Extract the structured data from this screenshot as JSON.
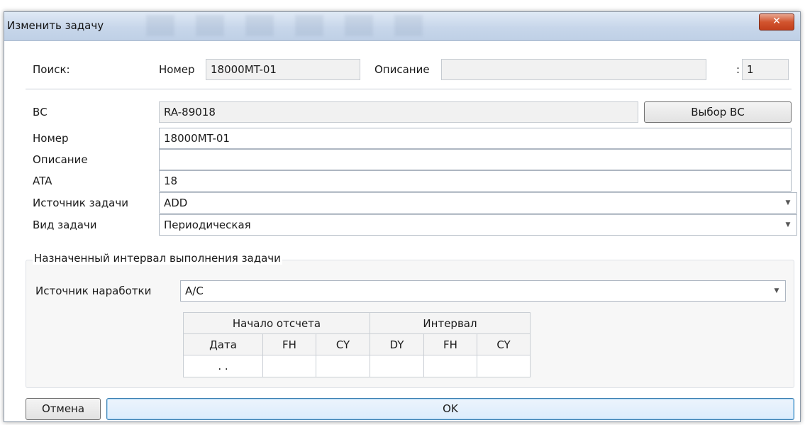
{
  "window": {
    "title": "Изменить задачу",
    "close_glyph": "✕"
  },
  "search": {
    "label": "Поиск:",
    "number_label": "Номер",
    "number_value": "18000MT-01",
    "description_label": "Описание",
    "description_value": "",
    "count_label": ":",
    "count_value": "1"
  },
  "fields": {
    "vs_label": "ВС",
    "vs_value": "RA-89018",
    "vs_button": "Выбор ВС",
    "number_label": "Номер",
    "number_value": "18000MT-01",
    "description_label": "Описание",
    "description_value": "",
    "ata_label": "ATA",
    "ata_value": "18",
    "source_label": "Источник задачи",
    "source_value": "ADD",
    "type_label": "Вид задачи",
    "type_value": "Периодическая"
  },
  "interval_group": {
    "title": "Назначенный интервал выполнения задачи",
    "runtime_source_label": "Источник наработки",
    "runtime_source_value": "A/C",
    "table": {
      "group_start": "Начало отсчета",
      "group_interval": "Интервал",
      "columns": [
        "Дата",
        "FH",
        "CY",
        "DY",
        "FH",
        "CY"
      ],
      "row": [
        ". .",
        "",
        "",
        "",
        "",
        ""
      ]
    }
  },
  "buttons": {
    "cancel": "Отмена",
    "ok": "OK"
  },
  "icons": {
    "dropdown": "chevron-down-icon",
    "close": "close-icon"
  }
}
